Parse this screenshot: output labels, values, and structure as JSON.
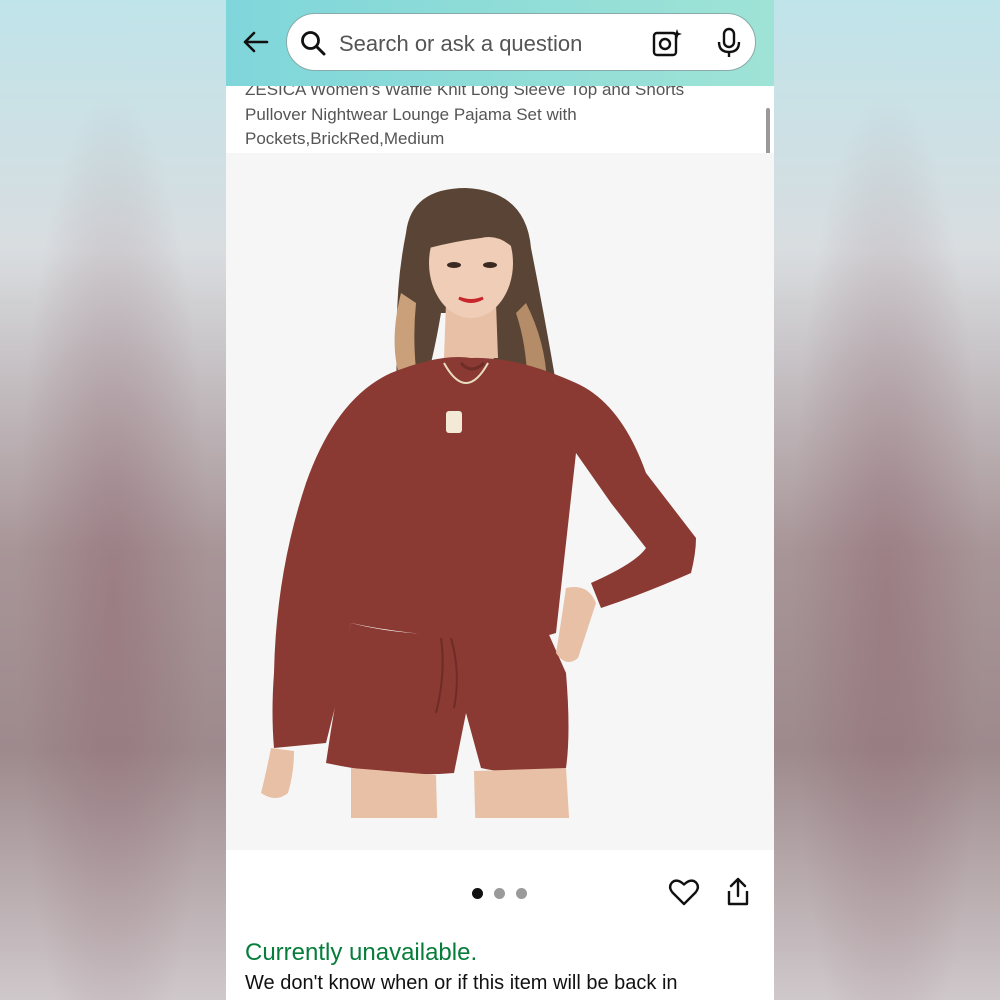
{
  "search": {
    "placeholder": "Search or ask a question"
  },
  "icons": {
    "back": "arrow-left-icon",
    "search": "search-icon",
    "camera": "camera-lens-icon",
    "mic": "microphone-icon",
    "heart": "heart-icon",
    "share": "share-icon"
  },
  "product": {
    "title": "ZESICA Women's Waffle Knit Long Sleeve Top and Shorts Pullover Nightwear Lounge Pajama Set with Pockets,BrickRed,Medium",
    "image_count": 3,
    "active_image_index": 0,
    "outfit_color": "#8a3a33"
  },
  "availability": {
    "status": "Currently unavailable.",
    "note": "We don't know when or if this item will be back in"
  },
  "colors": {
    "header_gradient_start": "#7fd6da",
    "header_gradient_end": "#9fe3d6",
    "availability_green": "#067d3a"
  }
}
